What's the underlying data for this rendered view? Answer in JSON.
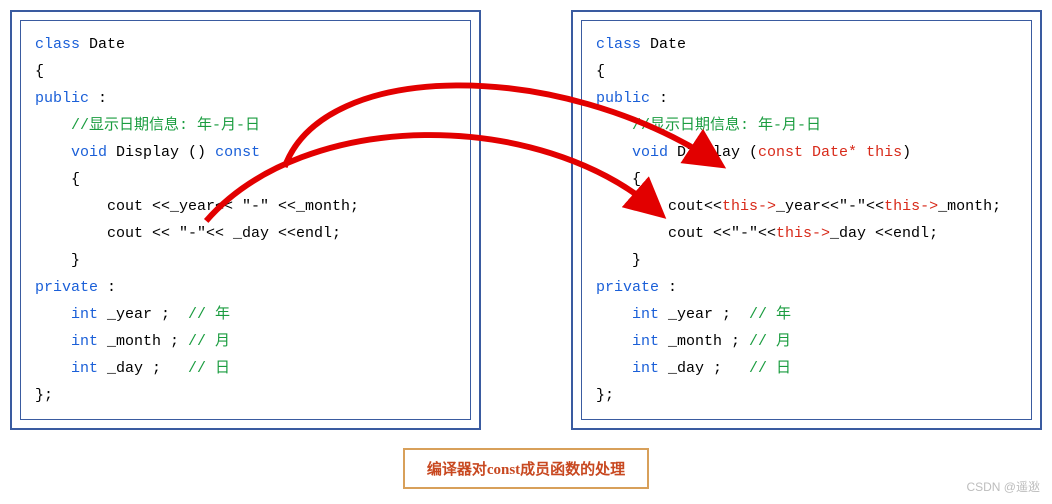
{
  "left": {
    "l1a": "class",
    "l1b": " Date",
    "l2": "{",
    "l3a": "public",
    "l3b": " :",
    "l4": "    //显示日期信息: 年-月-日",
    "l5a": "    ",
    "l5b": "void",
    "l5c": " Display () ",
    "l5d": "const",
    "l6": "    {",
    "l7": "        cout <<_year<< \"-\" <<_month;",
    "l8": "        cout << \"-\"<< _day <<endl;",
    "l9": "    }",
    "l10a": "private",
    "l10b": " :",
    "l11a": "    ",
    "l11b": "int",
    "l11c": " _year ;  ",
    "l11d": "// 年",
    "l12a": "    ",
    "l12b": "int",
    "l12c": " _month ; ",
    "l12d": "// 月",
    "l13a": "    ",
    "l13b": "int",
    "l13c": " _day ;   ",
    "l13d": "// 日",
    "l14": "};"
  },
  "right": {
    "l1a": "class",
    "l1b": " Date",
    "l2": "{",
    "l3a": "public",
    "l3b": " :",
    "l4": "    //显示日期信息: 年-月-日",
    "l5a": "    ",
    "l5b": "void",
    "l5c": " Display (",
    "l5d": "const Date* this",
    "l5e": ")",
    "l6": "    {",
    "l7a": "        cout<<",
    "l7b": "this->",
    "l7c": "_year<<\"-\"<<",
    "l7d": "this->",
    "l7e": "_month;",
    "l8a": "        cout <<\"-\"<<",
    "l8b": "this->",
    "l8c": "_day <<endl;",
    "l9": "    }",
    "l10a": "private",
    "l10b": " :",
    "l11a": "    ",
    "l11b": "int",
    "l11c": " _year ;  ",
    "l11d": "// 年",
    "l12a": "    ",
    "l12b": "int",
    "l12c": " _month ; ",
    "l12d": "// 月",
    "l13a": "    ",
    "l13b": "int",
    "l13c": " _day ;   ",
    "l13d": "// 日",
    "l14": "};"
  },
  "caption": "编译器对const成员函数的处理",
  "watermark": "CSDN @遥逖"
}
